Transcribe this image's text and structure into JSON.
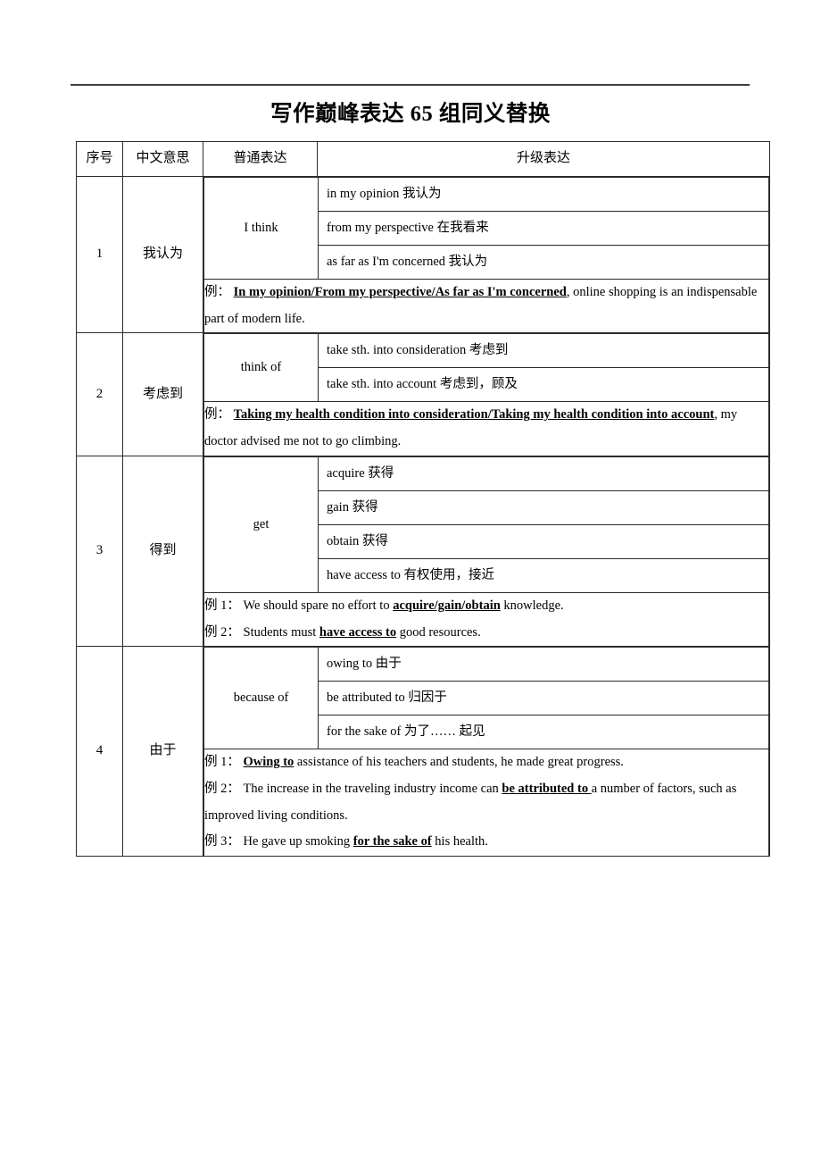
{
  "document": {
    "title": "写作巅峰表达 65 组同义替换",
    "has_top_rule": true
  },
  "table": {
    "headers": {
      "number": "序号",
      "meaning": "中文意思",
      "basic": "普通表达",
      "upgraded": "升级表达"
    },
    "rows": [
      {
        "number": "1",
        "meaning": "我认为",
        "basic": "I think",
        "upgraded": [
          "in my opinion  我认为",
          "from my perspective  在我看来",
          "as far as I'm concerned  我认为"
        ],
        "examples": [
          {
            "label": "例：",
            "parts": [
              {
                "text": "In my opinion/From my perspective/As far as I'm concerned",
                "bold_underline": true
              },
              {
                "text": ", online shopping is an indispensable part of modern life.",
                "bold_underline": false
              }
            ]
          }
        ]
      },
      {
        "number": "2",
        "meaning": "考虑到",
        "basic": "think of",
        "upgraded": [
          "take sth. into consideration  考虑到",
          "take sth. into account  考虑到，顾及"
        ],
        "examples": [
          {
            "label": "例：",
            "parts": [
              {
                "text": "Taking my health condition into consideration/Taking my health condition into account",
                "bold_underline": true
              },
              {
                "text": ", my doctor advised me not to go climbing.",
                "bold_underline": false
              }
            ]
          }
        ]
      },
      {
        "number": "3",
        "meaning": "得到",
        "basic": "get",
        "upgraded": [
          "acquire  获得",
          "gain  获得",
          "obtain  获得",
          "have access to  有权使用，接近"
        ],
        "examples": [
          {
            "label": "例 1：",
            "parts": [
              {
                "text": "We should spare no effort to ",
                "bold_underline": false
              },
              {
                "text": "acquire/gain/obtain",
                "bold_underline": true
              },
              {
                "text": " knowledge.",
                "bold_underline": false
              }
            ]
          },
          {
            "label": "例 2：",
            "parts": [
              {
                "text": "Students must ",
                "bold_underline": false
              },
              {
                "text": "have access to",
                "bold_underline": true
              },
              {
                "text": " good resources.",
                "bold_underline": false
              }
            ]
          }
        ]
      },
      {
        "number": "4",
        "meaning": "由于",
        "basic": "because of",
        "upgraded": [
          "owing to  由于",
          "be attributed to  归因于",
          "for the sake of  为了…… 起见"
        ],
        "examples": [
          {
            "label": "例 1：",
            "parts": [
              {
                "text": "Owing to",
                "bold_underline": true
              },
              {
                "text": " assistance of his teachers and students, he made great progress.",
                "bold_underline": false
              }
            ]
          },
          {
            "label": "例 2：",
            "parts": [
              {
                "text": "The increase in the traveling industry income can ",
                "bold_underline": false
              },
              {
                "text": "be attributed to ",
                "bold_underline": true
              },
              {
                "text": "a number of factors, such as improved living conditions.",
                "bold_underline": false
              }
            ]
          },
          {
            "label": "例 3：",
            "parts": [
              {
                "text": "He gave up smoking ",
                "bold_underline": false
              },
              {
                "text": "for the sake of",
                "bold_underline": true
              },
              {
                "text": " his health.",
                "bold_underline": false
              }
            ]
          }
        ]
      }
    ]
  },
  "colors": {
    "border": "#2b2b2b",
    "rule": "#3d3d3d",
    "text": "#000000",
    "background": "#ffffff"
  }
}
